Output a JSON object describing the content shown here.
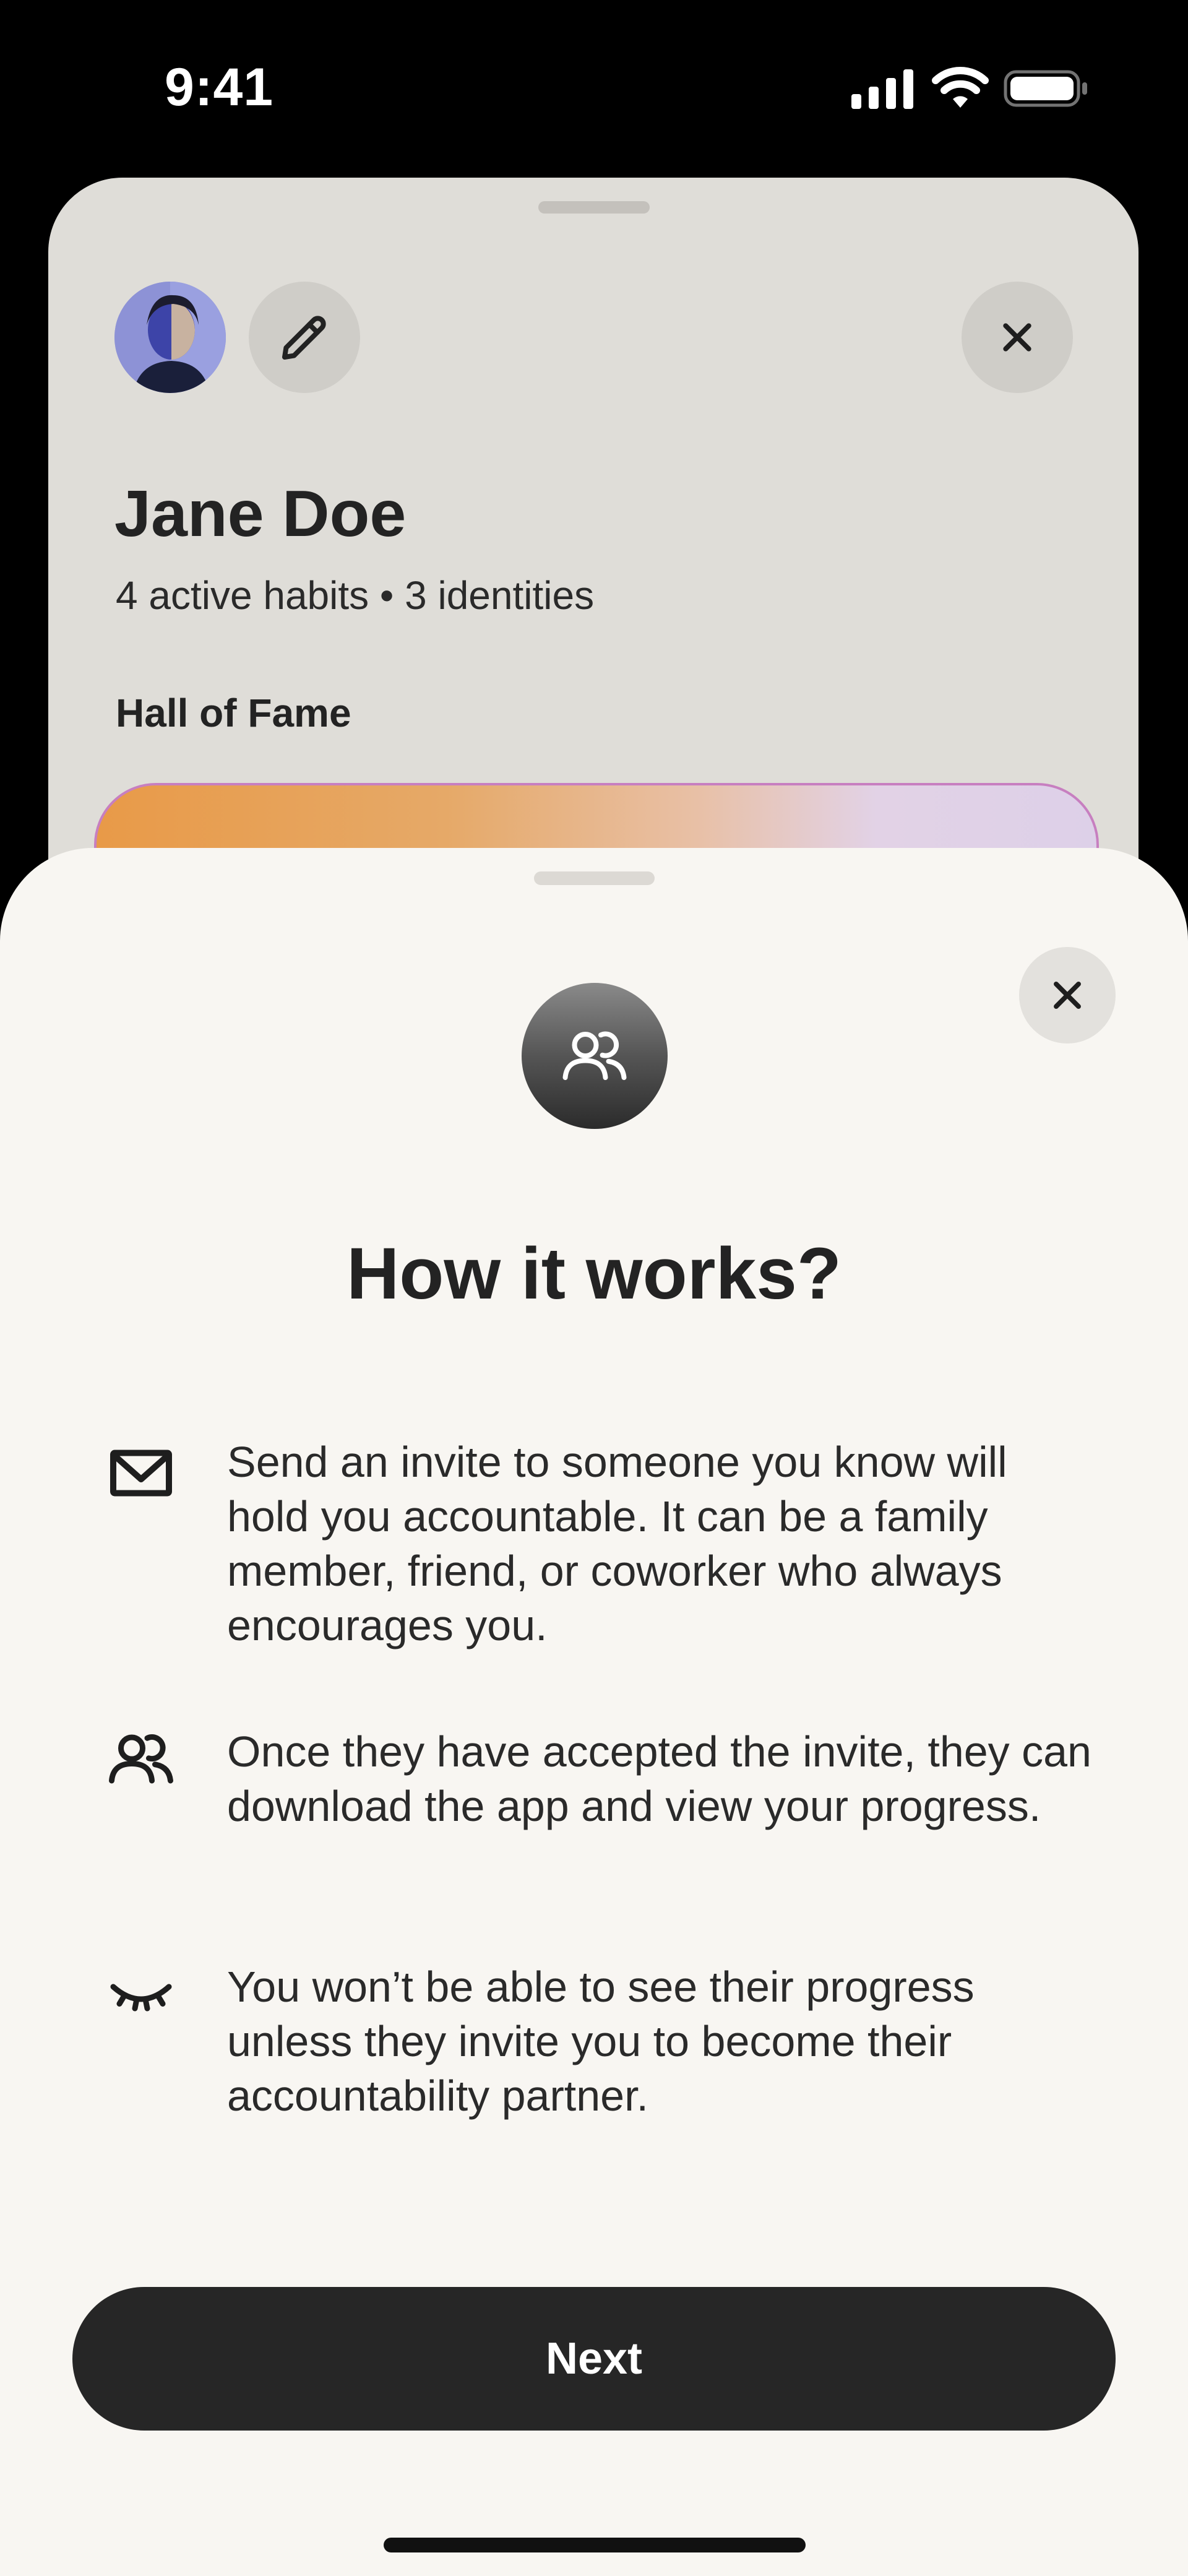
{
  "status_bar": {
    "time": "9:41",
    "icons": [
      "cellular-signal-icon",
      "wifi-icon",
      "battery-icon"
    ]
  },
  "profile": {
    "name": "Jane Doe",
    "stats": "4 active habits • 3 identities",
    "hall_of_fame_title": "Hall of Fame",
    "icons": {
      "avatar": "avatar",
      "edit": "pencil-icon",
      "close": "close-icon"
    }
  },
  "modal": {
    "title": "How it works?",
    "badge_icon": "users-icon",
    "close_icon": "close-icon",
    "steps": [
      {
        "icon": "envelope-icon",
        "text": "Send an invite to someone you know will hold you accountable. It can be a family member, friend, or coworker who always encourages you."
      },
      {
        "icon": "users-icon",
        "text": "Once they have accepted the invite, they can download the app and view your progress."
      },
      {
        "icon": "eye-closed-icon",
        "text": "You won’t be able to see their progress unless they invite you to become their accountability partner."
      }
    ],
    "next_label": "Next"
  },
  "colors": {
    "modal_background": "#f8f6f2",
    "profile_background": "#dfddd8",
    "button_dark": "#262626",
    "hall_card_gradient_start": "#e89a48",
    "hall_card_gradient_end": "#ddd0e8"
  }
}
